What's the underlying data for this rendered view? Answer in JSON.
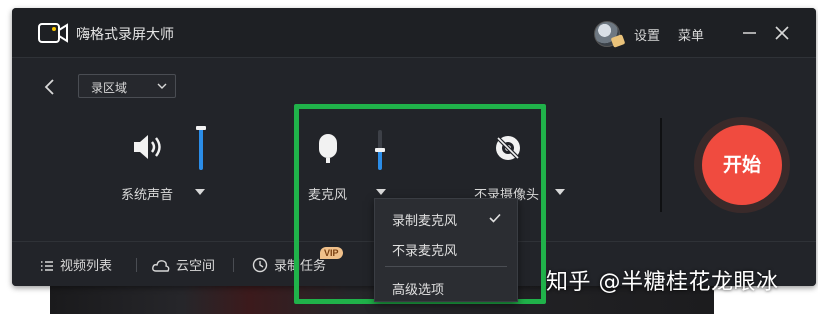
{
  "app": {
    "title": "嗨格式录屏大师",
    "settings_label": "设置",
    "menu_label": "菜单"
  },
  "toolbar": {
    "region_select": "录区域"
  },
  "sources": [
    {
      "label": "系统声音",
      "icon": "speaker-icon",
      "level": 1.0
    },
    {
      "label": "麦克风",
      "icon": "microphone-icon",
      "level": 0.5
    },
    {
      "label": "不录摄像头",
      "icon": "camera-off-icon"
    }
  ],
  "start_button": {
    "label": "开始",
    "color": "#f04b3f"
  },
  "bottom_bar": {
    "video_list": "视频列表",
    "cloud_space": "云空间",
    "record_task": "录制任务",
    "vip_badge": "VIP"
  },
  "mic_menu": {
    "items": [
      "录制麦克风",
      "不录麦克风",
      "高级选项"
    ],
    "checked_index": 0
  },
  "watermark": "知乎 @半糖桂花龙眼冰",
  "colors": {
    "accent": "#2b8de8",
    "highlight_border": "#20b24a",
    "window_bg": "#222429"
  }
}
